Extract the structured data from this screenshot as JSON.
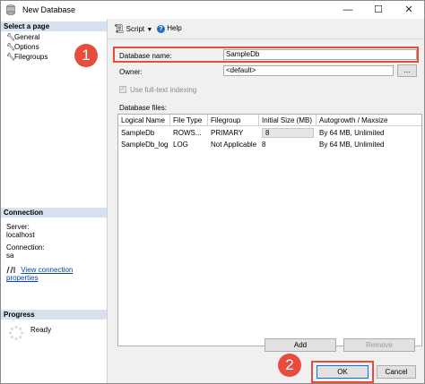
{
  "window": {
    "title": "New Database",
    "minimize": "—",
    "maximize": "☐",
    "close": "✕"
  },
  "left": {
    "select_page_header": "Select a page",
    "pages": [
      {
        "label": "General",
        "icon": "wrench-icon"
      },
      {
        "label": "Options",
        "icon": "wrench-icon"
      },
      {
        "label": "Filegroups",
        "icon": "wrench-icon"
      }
    ],
    "connection_header": "Connection",
    "server_label": "Server:",
    "server_value": "localhost",
    "connection_label": "Connection:",
    "connection_value": "sa",
    "view_link": "View connection properties",
    "progress_header": "Progress",
    "progress_status": "Ready"
  },
  "toolbar": {
    "script_label": "Script",
    "help_label": "Help"
  },
  "form": {
    "db_name_label": "Database name:",
    "db_name_value": "SampleDb",
    "owner_label": "Owner:",
    "owner_value": "<default>",
    "owner_browse": "...",
    "fulltext_label": "Use full-text indexing",
    "files_label": "Database files:"
  },
  "grid": {
    "columns": [
      "Logical Name",
      "File Type",
      "Filegroup",
      "Initial Size (MB)",
      "Autogrowth / Maxsize"
    ],
    "rows": [
      [
        "SampleDb",
        "ROWS...",
        "PRIMARY",
        "8",
        "By 64 MB, Unlimited"
      ],
      [
        "SampleDb_log",
        "LOG",
        "Not Applicable",
        "8",
        "By 64 MB, Unlimited"
      ]
    ]
  },
  "buttons": {
    "add": "Add",
    "remove": "Remove",
    "ok": "OK",
    "cancel": "Cancel"
  },
  "callouts": {
    "one": "1",
    "two": "2"
  },
  "colors": {
    "accent_red": "#e74c3c",
    "header_blue": "#d7e2ee"
  }
}
